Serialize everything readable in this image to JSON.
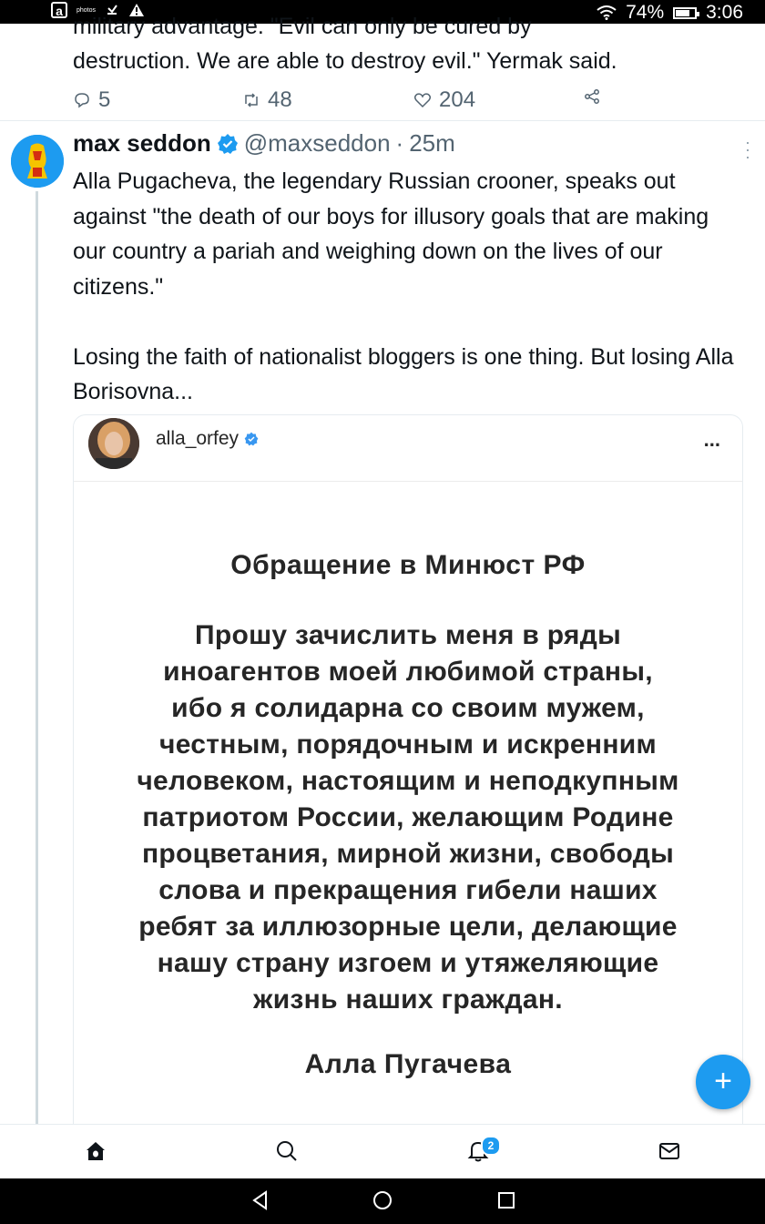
{
  "status_bar": {
    "photos_label": "photos",
    "battery_percent": "74%",
    "battery_level": 0.74,
    "time": "3:06"
  },
  "previous_tweet": {
    "text_line1": "military advantage. \"Evil can only be cured by",
    "text_line2": "destruction. We are able to destroy evil.\" Yermak said.",
    "replies": "5",
    "retweets": "48",
    "likes": "204"
  },
  "tweet": {
    "author_name": "max seddon",
    "handle": "@maxseddon",
    "separator": "·",
    "time": "25m",
    "paragraph1": "Alla Pugacheva, the legendary Russian crooner, speaks out against \"the death of our boys for illusory goals that are making our country a pariah and weighing down on the lives of our citizens.\"",
    "paragraph2": "Losing the faith of nationalist bloggers is one thing. But losing Alla Borisovna..."
  },
  "embedded_post": {
    "username": "alla_orfey",
    "more": "...",
    "title": "Обращение в Минюст РФ",
    "body_lines": [
      "Прошу зачислить меня в ряды",
      "иноагентов моей любимой страны,",
      "ибо я солидарна со своим мужем,",
      "честным, порядочным и искренним",
      "человеком, настоящим и неподкупным",
      "патриотом России, желающим Родине",
      "процветания, мирной жизни, свободы",
      "слова и прекращения гибели наших",
      "ребят за иллюзорные цели, делающие",
      "нашу страну изгоем и утяжеляющие",
      "жизнь наших граждан."
    ],
    "signature": "Алла Пугачева"
  },
  "fab": {
    "icon": "plus-icon",
    "label": "+"
  },
  "bottom_nav": {
    "items": [
      "home-icon",
      "search-icon",
      "notifications-icon",
      "messages-icon"
    ],
    "notification_count": "2"
  },
  "colors": {
    "accent": "#1d9bf0",
    "text": "#0f1419",
    "muted": "#536471"
  }
}
